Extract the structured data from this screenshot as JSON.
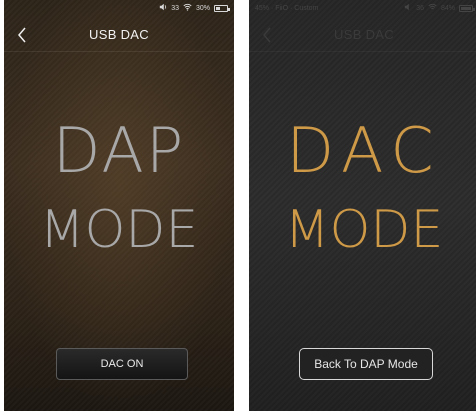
{
  "left_screen": {
    "status": {
      "volume": "33",
      "battery": "30%"
    },
    "title": "USB DAC",
    "line1": "DAP",
    "line2": "MODE",
    "button": "DAC ON"
  },
  "right_screen": {
    "status": {
      "left_text": "45% · FiiO · Custom",
      "volume": "36",
      "battery": "84%"
    },
    "title": "USB DAC",
    "line1": "DAC",
    "line2": "MODE",
    "button": "Back To DAP Mode"
  },
  "colors": {
    "dap_text": "#a8a8a8",
    "dac_text": "#cf9a47"
  },
  "icons": [
    "chevron-left-icon",
    "volume-icon",
    "wifi-icon",
    "battery-icon"
  ]
}
